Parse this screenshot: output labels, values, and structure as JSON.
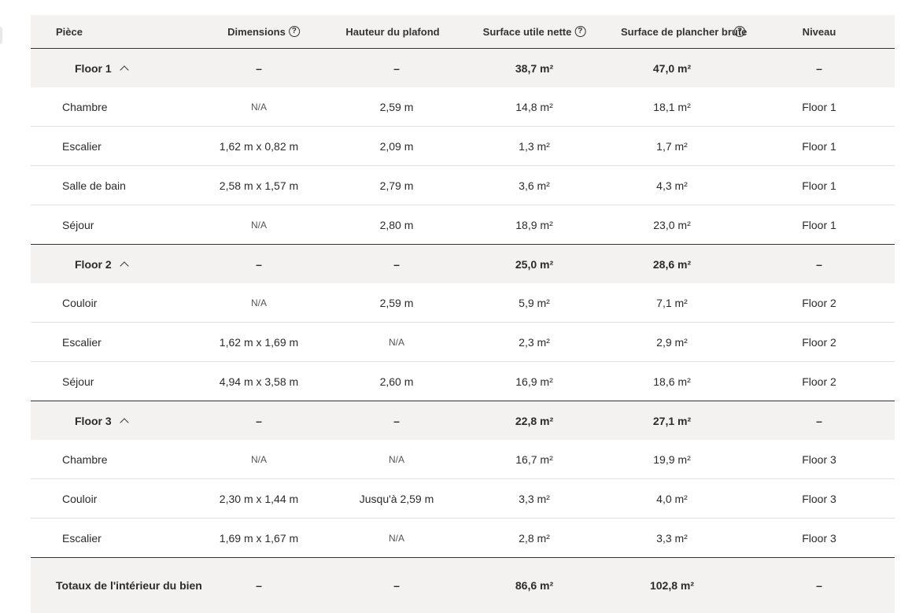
{
  "headers": {
    "piece": "Pièce",
    "dimensions": "Dimensions",
    "hauteur": "Hauteur du plafond",
    "nette": "Surface utile nette",
    "brute": "Surface de plancher brute",
    "niveau": "Niveau"
  },
  "groups": [
    {
      "name": "Floor 1",
      "dimensions": "–",
      "hauteur": "–",
      "nette": "38,7 m²",
      "brute": "47,0 m²",
      "niveau": "–",
      "rooms": [
        {
          "name": "Chambre",
          "dimensions": "N/A",
          "hauteur": "2,59 m",
          "nette": "14,8 m²",
          "brute": "18,1 m²",
          "niveau": "Floor 1"
        },
        {
          "name": "Escalier",
          "dimensions": "1,62 m x 0,82 m",
          "hauteur": "2,09 m",
          "nette": "1,3 m²",
          "brute": "1,7 m²",
          "niveau": "Floor 1"
        },
        {
          "name": "Salle de bain",
          "dimensions": "2,58 m x 1,57 m",
          "hauteur": "2,79 m",
          "nette": "3,6 m²",
          "brute": "4,3 m²",
          "niveau": "Floor 1"
        },
        {
          "name": "Séjour",
          "dimensions": "N/A",
          "hauteur": "2,80 m",
          "nette": "18,9 m²",
          "brute": "23,0 m²",
          "niveau": "Floor 1"
        }
      ]
    },
    {
      "name": "Floor 2",
      "dimensions": "–",
      "hauteur": "–",
      "nette": "25,0 m²",
      "brute": "28,6 m²",
      "niveau": "–",
      "rooms": [
        {
          "name": "Couloir",
          "dimensions": "N/A",
          "hauteur": "2,59 m",
          "nette": "5,9 m²",
          "brute": "7,1 m²",
          "niveau": "Floor 2"
        },
        {
          "name": "Escalier",
          "dimensions": "1,62 m x 1,69 m",
          "hauteur": "N/A",
          "nette": "2,3 m²",
          "brute": "2,9 m²",
          "niveau": "Floor 2"
        },
        {
          "name": "Séjour",
          "dimensions": "4,94 m x 3,58 m",
          "hauteur": "2,60 m",
          "nette": "16,9 m²",
          "brute": "18,6 m²",
          "niveau": "Floor 2"
        }
      ]
    },
    {
      "name": "Floor 3",
      "dimensions": "–",
      "hauteur": "–",
      "nette": "22,8 m²",
      "brute": "27,1 m²",
      "niveau": "–",
      "rooms": [
        {
          "name": "Chambre",
          "dimensions": "N/A",
          "hauteur": "N/A",
          "nette": "16,7 m²",
          "brute": "19,9 m²",
          "niveau": "Floor 3"
        },
        {
          "name": "Couloir",
          "dimensions": "2,30 m x 1,44 m",
          "hauteur": "Jusqu'à 2,59 m",
          "nette": "3,3 m²",
          "brute": "4,0 m²",
          "niveau": "Floor 3"
        },
        {
          "name": "Escalier",
          "dimensions": "1,69 m x 1,67 m",
          "hauteur": "N/A",
          "nette": "2,8 m²",
          "brute": "3,3 m²",
          "niveau": "Floor 3"
        }
      ]
    }
  ],
  "totals": {
    "label": "Totaux de l'intérieur du bien",
    "dimensions": "–",
    "hauteur": "–",
    "nette": "86,6 m²",
    "brute": "102,8 m²",
    "niveau": "–"
  },
  "icons": {
    "help": "help-circle-icon",
    "collapse": "chevron-up-icon"
  }
}
